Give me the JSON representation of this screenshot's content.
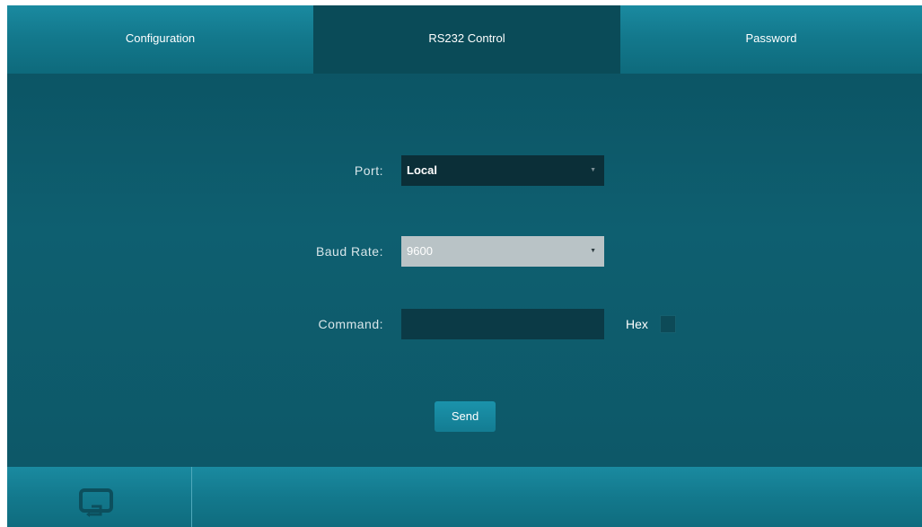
{
  "tabs": [
    {
      "label": "Configuration",
      "active": false
    },
    {
      "label": "RS232 Control",
      "active": true
    },
    {
      "label": "Password",
      "active": false
    }
  ],
  "form": {
    "port": {
      "label": "Port:",
      "value": "Local"
    },
    "baud_rate": {
      "label": "Baud Rate:",
      "value": "9600"
    },
    "command": {
      "label": "Command:",
      "value": ""
    },
    "hex": {
      "label": "Hex",
      "checked": false
    },
    "send_label": "Send"
  },
  "footer": {
    "icon": "return-icon"
  },
  "colors": {
    "background": "#0e5f70",
    "tab_inactive": "#13798d",
    "tab_active": "#0a4b58",
    "field_dark": "#0b2f38",
    "field_disabled": "#b9c3c6",
    "button": "#1b93ab"
  }
}
